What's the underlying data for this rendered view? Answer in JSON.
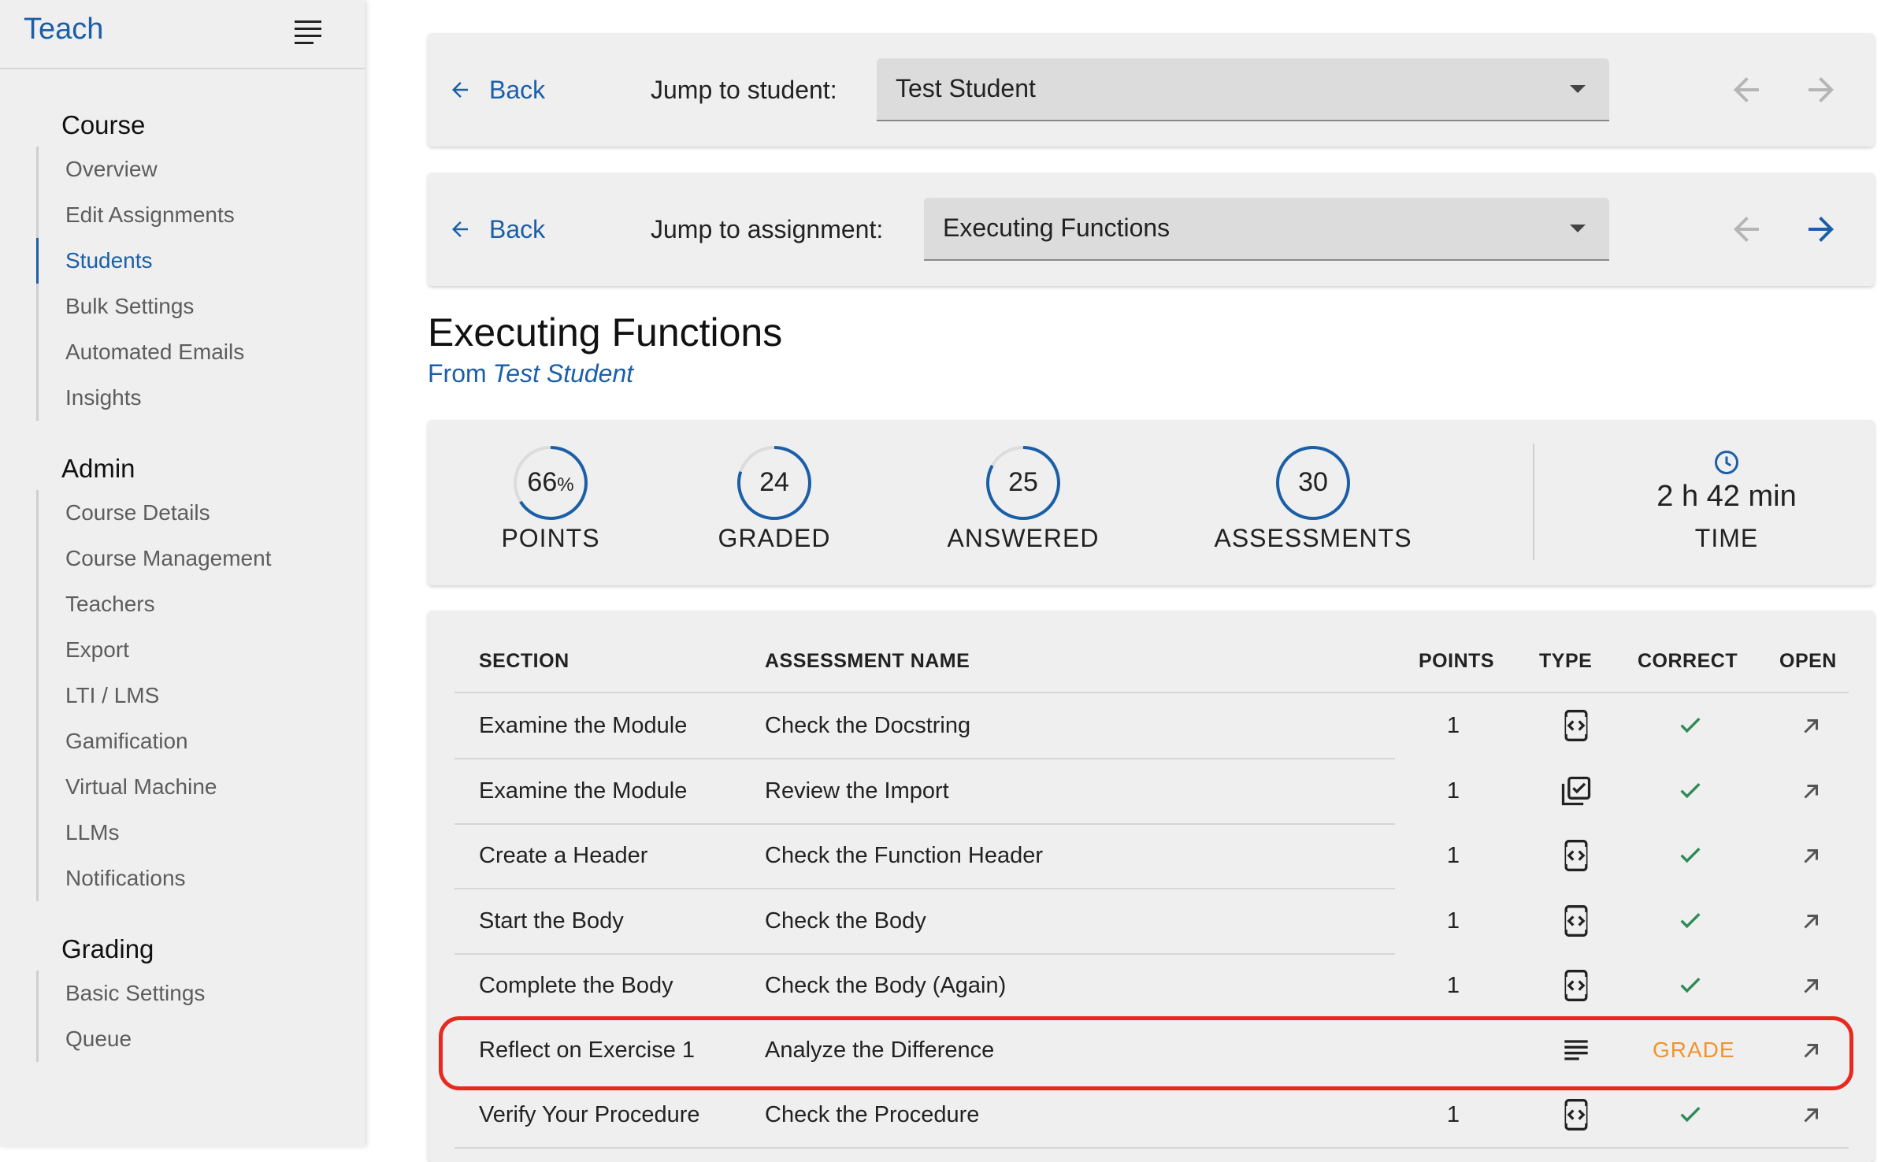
{
  "sidebar": {
    "brand": "Teach",
    "groups": [
      {
        "title": "Course",
        "items": [
          "Overview",
          "Edit Assignments",
          "Students",
          "Bulk Settings",
          "Automated Emails",
          "Insights"
        ]
      },
      {
        "title": "Admin",
        "items": [
          "Course Details",
          "Course Management",
          "Teachers",
          "Export",
          "LTI / LMS",
          "Gamification",
          "Virtual Machine",
          "LLMs",
          "Notifications"
        ]
      },
      {
        "title": "Grading",
        "items": [
          "Basic Settings",
          "Queue"
        ]
      }
    ],
    "active_item": "Students"
  },
  "student_nav": {
    "back_label": "Back",
    "jump_label": "Jump to student:",
    "selected": "Test Student"
  },
  "assignment_nav": {
    "back_label": "Back",
    "jump_label": "Jump to assignment:",
    "selected": "Executing Functions"
  },
  "header": {
    "title": "Executing Functions",
    "from_label": "From",
    "student_name": "Test Student"
  },
  "stats": {
    "points": {
      "value": "66",
      "unit": "%",
      "label": "POINTS",
      "fill": 0.66
    },
    "graded": {
      "value": "24",
      "label": "GRADED",
      "fill": 0.8
    },
    "answered": {
      "value": "25",
      "label": "ANSWERED",
      "fill": 0.83
    },
    "assessments": {
      "value": "30",
      "label": "ASSESSMENTS",
      "fill": 1.0
    },
    "time": {
      "value": "2 h 42 min",
      "label": "TIME"
    }
  },
  "table": {
    "headers": {
      "section": "SECTION",
      "name": "ASSESSMENT NAME",
      "points": "POINTS",
      "type": "TYPE",
      "correct": "CORRECT",
      "open": "OPEN"
    },
    "rows": [
      {
        "section": "Examine the Module",
        "name": "Check the Docstring",
        "points": "1",
        "type": "code-test-icon",
        "correct": "check"
      },
      {
        "section": "Examine the Module",
        "name": "Review the Import",
        "points": "1",
        "type": "checkbox-list-icon",
        "correct": "check"
      },
      {
        "section": "Create a Header",
        "name": "Check the Function Header",
        "points": "1",
        "type": "code-test-icon",
        "correct": "check"
      },
      {
        "section": "Start the Body",
        "name": "Check the Body",
        "points": "1",
        "type": "code-test-icon",
        "correct": "check"
      },
      {
        "section": "Complete the Body",
        "name": "Check the Body (Again)",
        "points": "1",
        "type": "code-test-icon",
        "correct": "check"
      },
      {
        "section": "Reflect on Exercise 1",
        "name": "Analyze the Difference",
        "points": "",
        "type": "free-text-icon",
        "correct": "GRADE"
      },
      {
        "section": "Verify Your Procedure",
        "name": "Check the Procedure",
        "points": "1",
        "type": "code-test-icon",
        "correct": "check"
      }
    ]
  },
  "colors": {
    "accent": "#1b5fa7",
    "check": "#2e8b57",
    "grade": "#f0942e",
    "highlight": "#e8291f"
  }
}
